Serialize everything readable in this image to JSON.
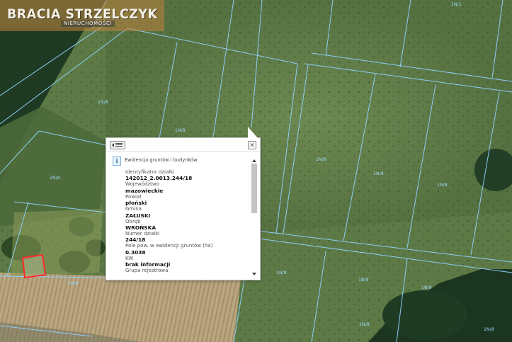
{
  "logo": {
    "name": "BRACIA STRZELCZYK",
    "tagline": "NIERUCHOMOŚCI"
  },
  "colors": {
    "parcel_line": "#8fd2ff",
    "highlight_parcel": "#ff2a2a",
    "popup_bg": "#ffffff"
  },
  "map_labels": [
    "1N/1",
    "1N/8",
    "1N/8",
    "1N/8",
    "1N/8",
    "1N/8",
    "1N/8",
    "1N/8",
    "1N/8",
    "1N/8",
    "1N/8",
    "1N/8",
    "1N/8"
  ],
  "popup": {
    "title": "Ewidencja gruntów i budynków",
    "icons": {
      "toolbar": "list-icon",
      "close": "close-icon",
      "info": "info-icon"
    },
    "close_glyph": "×",
    "info_glyph": "i",
    "fields": [
      {
        "label": "Identyfikator działki",
        "value": "142012_2.0013.244/18"
      },
      {
        "label": "Województwo",
        "value": "mazowieckie"
      },
      {
        "label": "Powiat",
        "value": "płoński"
      },
      {
        "label": "Gmina",
        "value": "ZAŁUSKI"
      },
      {
        "label": "Obręb",
        "value": "WROŃSKA"
      },
      {
        "label": "Numer działki",
        "value": "244/18"
      },
      {
        "label": "Pole pow. w ewidencji gruntów (ha)",
        "value": "0.3038"
      },
      {
        "label": "KW",
        "value": "brak informacji"
      },
      {
        "label": "Grupa rejestrowa",
        "value": ""
      }
    ]
  }
}
